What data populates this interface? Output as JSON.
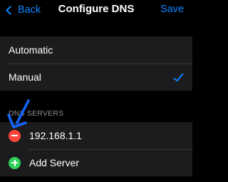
{
  "navbar": {
    "back_label": "Back",
    "title": "Configure DNS",
    "save_label": "Save"
  },
  "mode_options": [
    {
      "label": "Automatic",
      "selected": false
    },
    {
      "label": "Manual",
      "selected": true
    }
  ],
  "dns_servers": {
    "header": "DNS SERVERS",
    "servers": [
      "192.168.1.1"
    ],
    "add_label": "Add Server"
  },
  "colors": {
    "accent": "#0a84ff",
    "remove": "#ff453a",
    "add": "#30d158",
    "annotation_arrow": "#1565ff"
  },
  "icons": {
    "back": "chevron-left-icon",
    "selected": "checkmark-icon",
    "remove": "minus-circle-icon",
    "add": "plus-circle-icon"
  }
}
